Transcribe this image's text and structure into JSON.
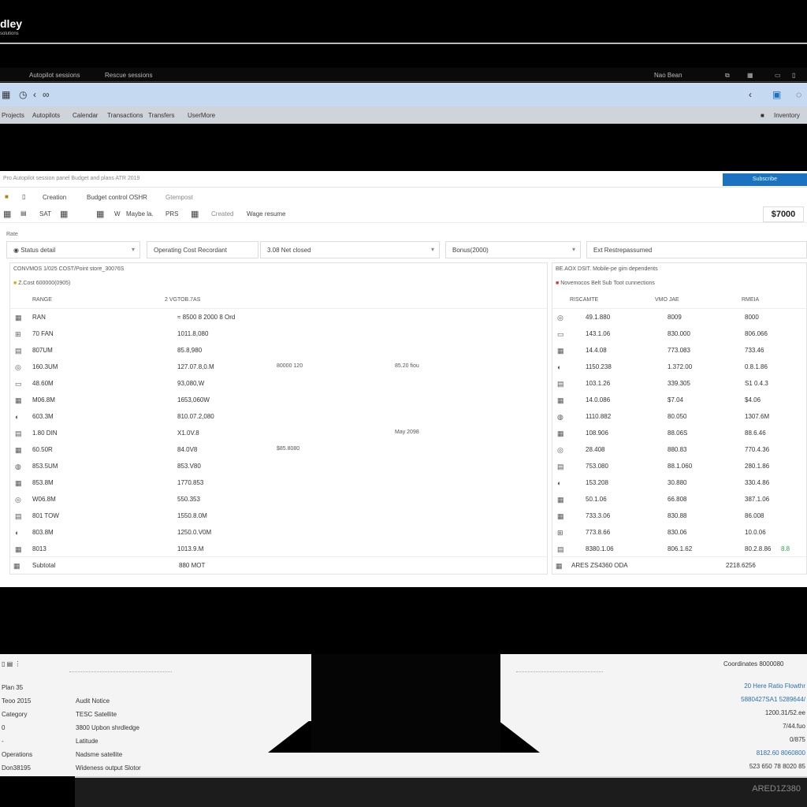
{
  "brand": {
    "logo": "dley",
    "sub": "solutions"
  },
  "tabstrip": {
    "left": [
      "Autopilot sessions",
      "Rescue sessions"
    ],
    "right": "Nao Bean"
  },
  "toolbar_icons": [
    "grid-icon",
    "clock-icon",
    "back-icon",
    "link-icon"
  ],
  "menu": [
    "Projects",
    "Autopilots",
    "Calendar",
    "Transactions",
    "Transfers",
    "UserMore"
  ],
  "menu_right": "Inventory",
  "breadcrumb": {
    "text": "Pro  Autopilot session panel  Budget and plans  ATR 2019",
    "button": "Subscribe"
  },
  "row2": [
    "Creation",
    "Budget control  OSHR",
    "Gtempost"
  ],
  "row3": [
    "SAT",
    "W",
    "Maybe la.",
    "PRS",
    "Created",
    "Wage resume"
  ],
  "amount": "$7000",
  "filter_label": "Rate",
  "filters": [
    "Status detail",
    "Operating Cost Recordant",
    "3.08 Net closed",
    "Bonus(2000)",
    "Ext Restrepassumed"
  ],
  "left_panel": {
    "title": "CONVMOS  1/025 COST/Point  store_30076S",
    "subtitle": "Z.Cost 600000(0905)",
    "headers": [
      "RANGE",
      "2 VGTOB.7AS"
    ],
    "rows": [
      [
        "RAN",
        "≈ 8500 8 2000 8 Ord",
        "",
        ""
      ],
      [
        "70 FAN",
        "1011.8,080",
        "",
        ""
      ],
      [
        "807UM",
        "85.8,980",
        "",
        ""
      ],
      [
        "160.3UM",
        "127.07.8,0.M",
        "80000 120",
        "85.20 fiou"
      ],
      [
        "48.60M",
        "93,080,W",
        "",
        ""
      ],
      [
        "M06.8M",
        "1653,060W",
        "",
        ""
      ],
      [
        "603.3M",
        "810.07.2,080",
        "",
        ""
      ],
      [
        "1.80 DIN",
        "X1.0V.8",
        "",
        "May 2098"
      ],
      [
        "60.50R",
        "84.0V8",
        "$85.8080",
        ""
      ],
      [
        "853.5UM",
        "853.V80",
        "",
        ""
      ],
      [
        "853.8M",
        "1770.853",
        "",
        ""
      ],
      [
        "W06.8M",
        "550.353",
        "",
        ""
      ],
      [
        "801 TOW",
        "1550.8.0M",
        "",
        ""
      ],
      [
        "803.8M",
        "1250.0.V0M",
        "",
        ""
      ],
      [
        "8013",
        "1013.9.M",
        "",
        ""
      ]
    ],
    "footer": [
      "Subtotal",
      "880 MOT"
    ]
  },
  "right_panel": {
    "title": "BE.AOX DSIT. Mobile-pe gim dependents",
    "subtitle": "Novemocos Belt Sub Toot cunnections",
    "headers": [
      "RISCAMTE",
      "VMO JAE",
      "RMEIA"
    ],
    "rows": [
      [
        "49.1.880",
        "8009",
        "8000"
      ],
      [
        "143.1.06",
        "830.000",
        "806.066"
      ],
      [
        "14.4.08",
        "773.083",
        "733.46"
      ],
      [
        "1150.238",
        "1.372.00",
        "0.8.1.86"
      ],
      [
        "103.1.26",
        "339.305",
        "S1 0.4.3"
      ],
      [
        "14.0.086",
        "$7.04",
        "$4.06"
      ],
      [
        "1110.882",
        "80.050",
        "1307.6M"
      ],
      [
        "108.906",
        "88.06S",
        "88.6.46"
      ],
      [
        "28.408",
        "880.83",
        "770.4.36"
      ],
      [
        "753.080",
        "88.1.060",
        "280.1.86"
      ],
      [
        "153.208",
        "30.880",
        "330.4.86"
      ],
      [
        "50.1.06",
        "66.808",
        "387.1.06"
      ],
      [
        "733.3.06",
        "830.88",
        "86.008"
      ],
      [
        "773.8.66",
        "830.06",
        "10.0.06"
      ],
      [
        "8380.1.06",
        "806.1.62",
        "80.2.8.86"
      ]
    ],
    "badge": "8.8",
    "badge_color": "#2aa84a",
    "footer": [
      "ARES ZS4360 ODA",
      "2218.6256"
    ]
  },
  "bottom": {
    "labels": [
      "Plan 35",
      "Teoo 2015",
      "Category",
      "0",
      "-",
      "Operations",
      "Don38195"
    ],
    "values": [
      "Audit Notice",
      "TESC Satellite",
      "3800 Upbon shrdledge",
      "Latitude",
      "Nadsme satellite",
      "Wideness output Slotor"
    ],
    "right_title": "Coordinates 8000080",
    "right_lines": [
      "20  Here Ratio Flowthr",
      "5880427SA1 5289644/",
      "1200.31/52.ee",
      "7/44.fuo",
      "0/875",
      "8182.60 8060800",
      "523 650 78 8020 85"
    ],
    "monitor": "ARED1Z380"
  },
  "colors": {
    "accent": "#1a72c0",
    "bluebar": "#c5d9f1",
    "menubar": "#cfd3da"
  }
}
